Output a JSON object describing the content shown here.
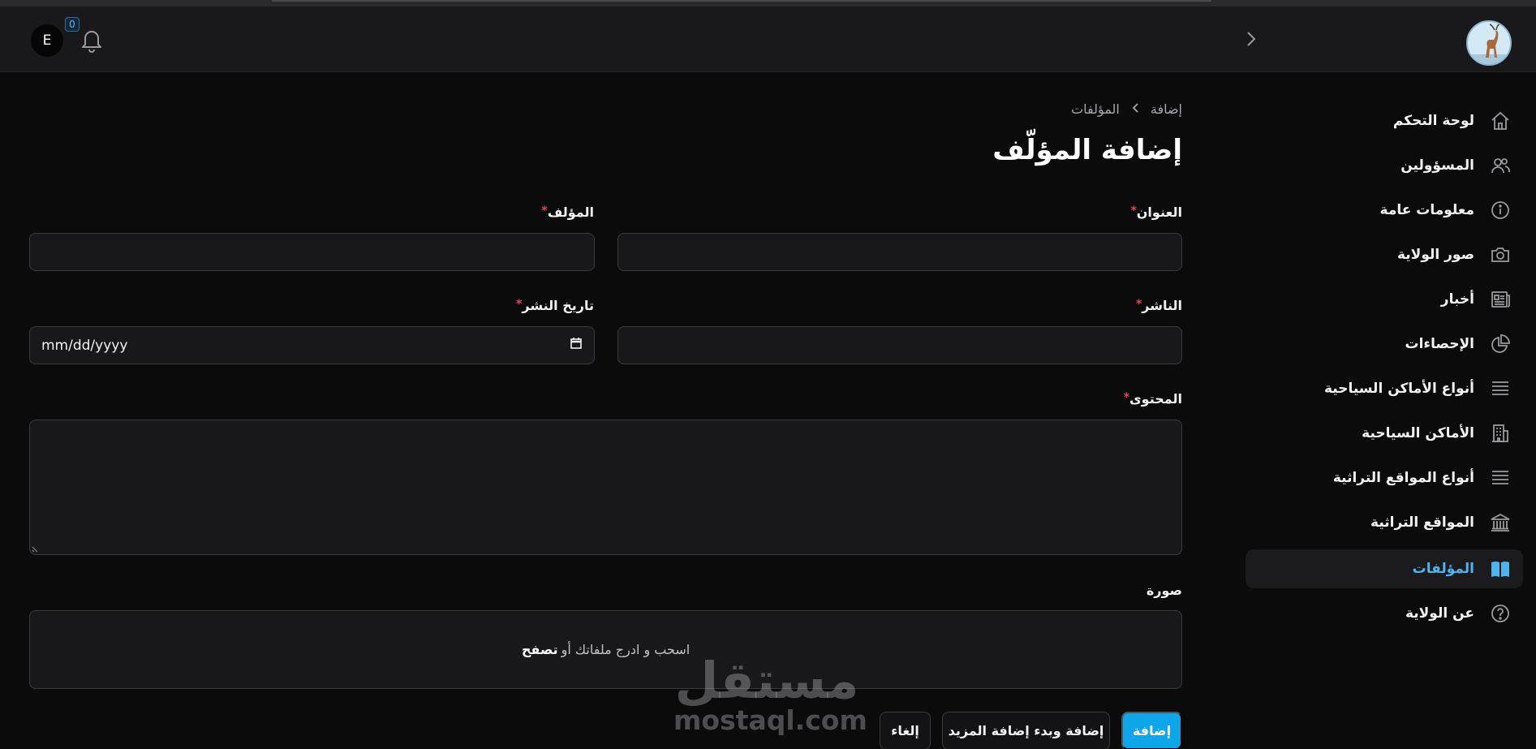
{
  "header": {
    "avatar_initial": "E",
    "notification_count": "0"
  },
  "sidebar": {
    "items": [
      {
        "label": "لوحة التحكم",
        "icon": "home-icon"
      },
      {
        "label": "المسؤولين",
        "icon": "users-icon"
      },
      {
        "label": "معلومات عامة",
        "icon": "info-icon"
      },
      {
        "label": "صور الولاية",
        "icon": "camera-icon"
      },
      {
        "label": "أخبار",
        "icon": "newspaper-icon"
      },
      {
        "label": "الإحصاءات",
        "icon": "pie-chart-icon"
      },
      {
        "label": "أنواع الأماكن السياحية",
        "icon": "list-icon"
      },
      {
        "label": "الأماكن السياحية",
        "icon": "building-icon"
      },
      {
        "label": "أنواع المواقع التراثية",
        "icon": "list-icon"
      },
      {
        "label": "المواقع التراثية",
        "icon": "landmark-icon"
      },
      {
        "label": "المؤلفات",
        "icon": "book-icon",
        "active": true
      },
      {
        "label": "عن الولاية",
        "icon": "question-icon"
      }
    ],
    "active_color": "#4fb4ee"
  },
  "breadcrumb": {
    "parent": "المؤلفات",
    "current": "إضافة"
  },
  "page": {
    "title": "إضافة المؤلّف"
  },
  "form": {
    "title_label": "العنوان",
    "author_label": "المؤلف",
    "publisher_label": "الناشر",
    "publish_date_label": "تاريخ النشر",
    "publish_date_placeholder": "mm/dd/yyyy",
    "content_label": "المحتوى",
    "image_label": "صورة",
    "dropzone_text": "اسحب و ادرج ملفاتك أو",
    "dropzone_browse": "تصفح",
    "required_mark": "*"
  },
  "actions": {
    "create": "إضافة",
    "create_another": "إضافة وبدء إضافة المزيد",
    "cancel": "إلغاء"
  },
  "watermark": {
    "arabic": "مستقل",
    "latin": "mostaql.com"
  },
  "colors": {
    "primary": "#0ea5e9",
    "required": "#e5484d",
    "background": "#0b0b0c"
  }
}
